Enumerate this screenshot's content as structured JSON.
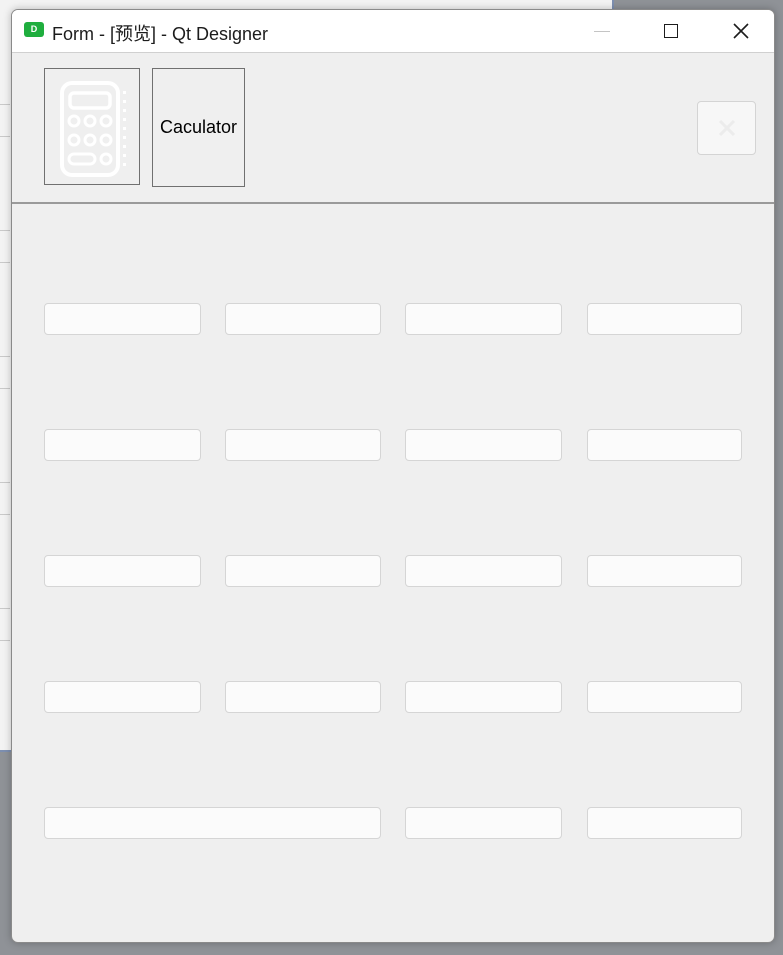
{
  "window": {
    "title": "Form - [预览] - Qt Designer",
    "app_icon_letter": "D",
    "app_icon_color": "#1fae3e"
  },
  "header": {
    "logo_icon": "calculator-icon",
    "caption": "Caculator",
    "close_button_icon": "close-icon"
  },
  "keypad": {
    "rows": [
      [
        "",
        "",
        "",
        ""
      ],
      [
        "",
        "",
        "",
        ""
      ],
      [
        "",
        "",
        "",
        ""
      ],
      [
        "",
        "",
        "",
        ""
      ],
      [
        "",
        "",
        ""
      ]
    ]
  },
  "colors": {
    "window_bg": "#efefef",
    "button_bg": "#fbfbfb",
    "button_border": "#d5d5d5"
  }
}
